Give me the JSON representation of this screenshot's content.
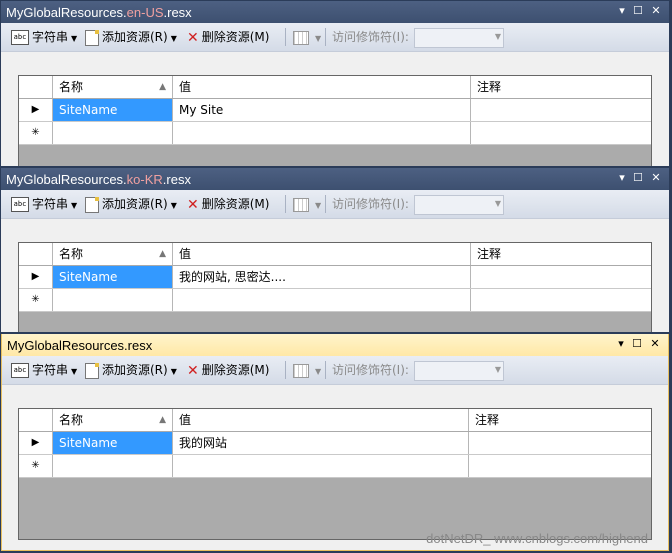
{
  "toolbar": {
    "strings_label": "字符串",
    "add_resource_label": "添加资源(R)",
    "delete_resource_label": "删除资源(M)",
    "access_modifier_label": "访问修饰符(I):"
  },
  "columns": [
    "名称",
    "值",
    "注释"
  ],
  "panels": [
    {
      "title_prefix": "MyGlobalResources.",
      "title_culture": "en-US",
      "title_suffix": ".resx",
      "row": {
        "name": "SiteName",
        "value": "My Site",
        "comment": ""
      }
    },
    {
      "title_prefix": "MyGlobalResources.",
      "title_culture": "ko-KR",
      "title_suffix": ".resx",
      "row": {
        "name": "SiteName",
        "value": "我的网站, 思密达....",
        "comment": ""
      }
    },
    {
      "title_prefix": "MyGlobalResources.resx",
      "title_culture": "",
      "title_suffix": "",
      "row": {
        "name": "SiteName",
        "value": "我的网站",
        "comment": ""
      }
    }
  ],
  "window_buttons": {
    "dropdown": "▾",
    "maximize": "☐",
    "close": "✕"
  },
  "new_row_marker": "✳",
  "current_row_marker": "▶",
  "watermark": "dotNetDR_ www.cnblogs.com/highend"
}
